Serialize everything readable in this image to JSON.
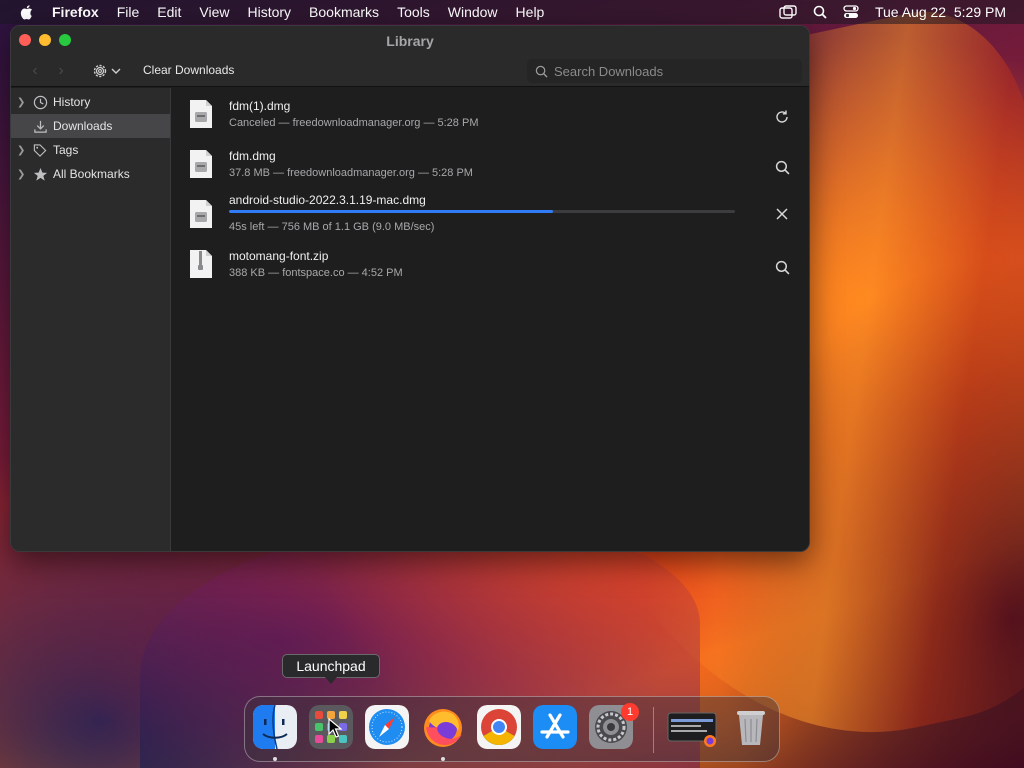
{
  "menubar": {
    "app_name": "Firefox",
    "menus": [
      "File",
      "Edit",
      "View",
      "History",
      "Bookmarks",
      "Tools",
      "Window",
      "Help"
    ],
    "clock": "Tue Aug 22  5:29 PM"
  },
  "window": {
    "title": "Library",
    "toolbar": {
      "clear_label": "Clear Downloads",
      "search_placeholder": "Search Downloads"
    },
    "sidebar": {
      "items": [
        {
          "label": "History",
          "icon": "clock-icon"
        },
        {
          "label": "Downloads",
          "icon": "download-icon",
          "selected": true
        },
        {
          "label": "Tags",
          "icon": "tag-icon"
        },
        {
          "label": "All Bookmarks",
          "icon": "star-icon"
        }
      ]
    },
    "downloads": [
      {
        "name": "fdm(1).dmg",
        "status": "Canceled — freedownloadmanager.org — 5:28 PM",
        "action": "retry-icon"
      },
      {
        "name": "fdm.dmg",
        "status": "37.8 MB — freedownloadmanager.org — 5:28 PM",
        "action": "search-icon"
      },
      {
        "name": "android-studio-2022.3.1.19-mac.dmg",
        "status": "45s left — 756 MB of 1.1 GB (9.0 MB/sec)",
        "action": "close-icon",
        "progress": 0.64
      },
      {
        "name": "motomang-font.zip",
        "status": "388 KB — fontspace.co — 4:52 PM",
        "action": "search-icon"
      }
    ]
  },
  "tooltip": {
    "label": "Launchpad"
  },
  "dock": {
    "apps": [
      "finder-icon",
      "launchpad-icon",
      "safari-icon",
      "firefox-icon",
      "chrome-icon",
      "app-store-icon",
      "system-settings-icon",
      "window-preview-icon",
      "trash-icon"
    ],
    "settings_badge": "1"
  },
  "colors": {
    "accent": "#2f7cf6",
    "badge": "#ff3b30"
  }
}
